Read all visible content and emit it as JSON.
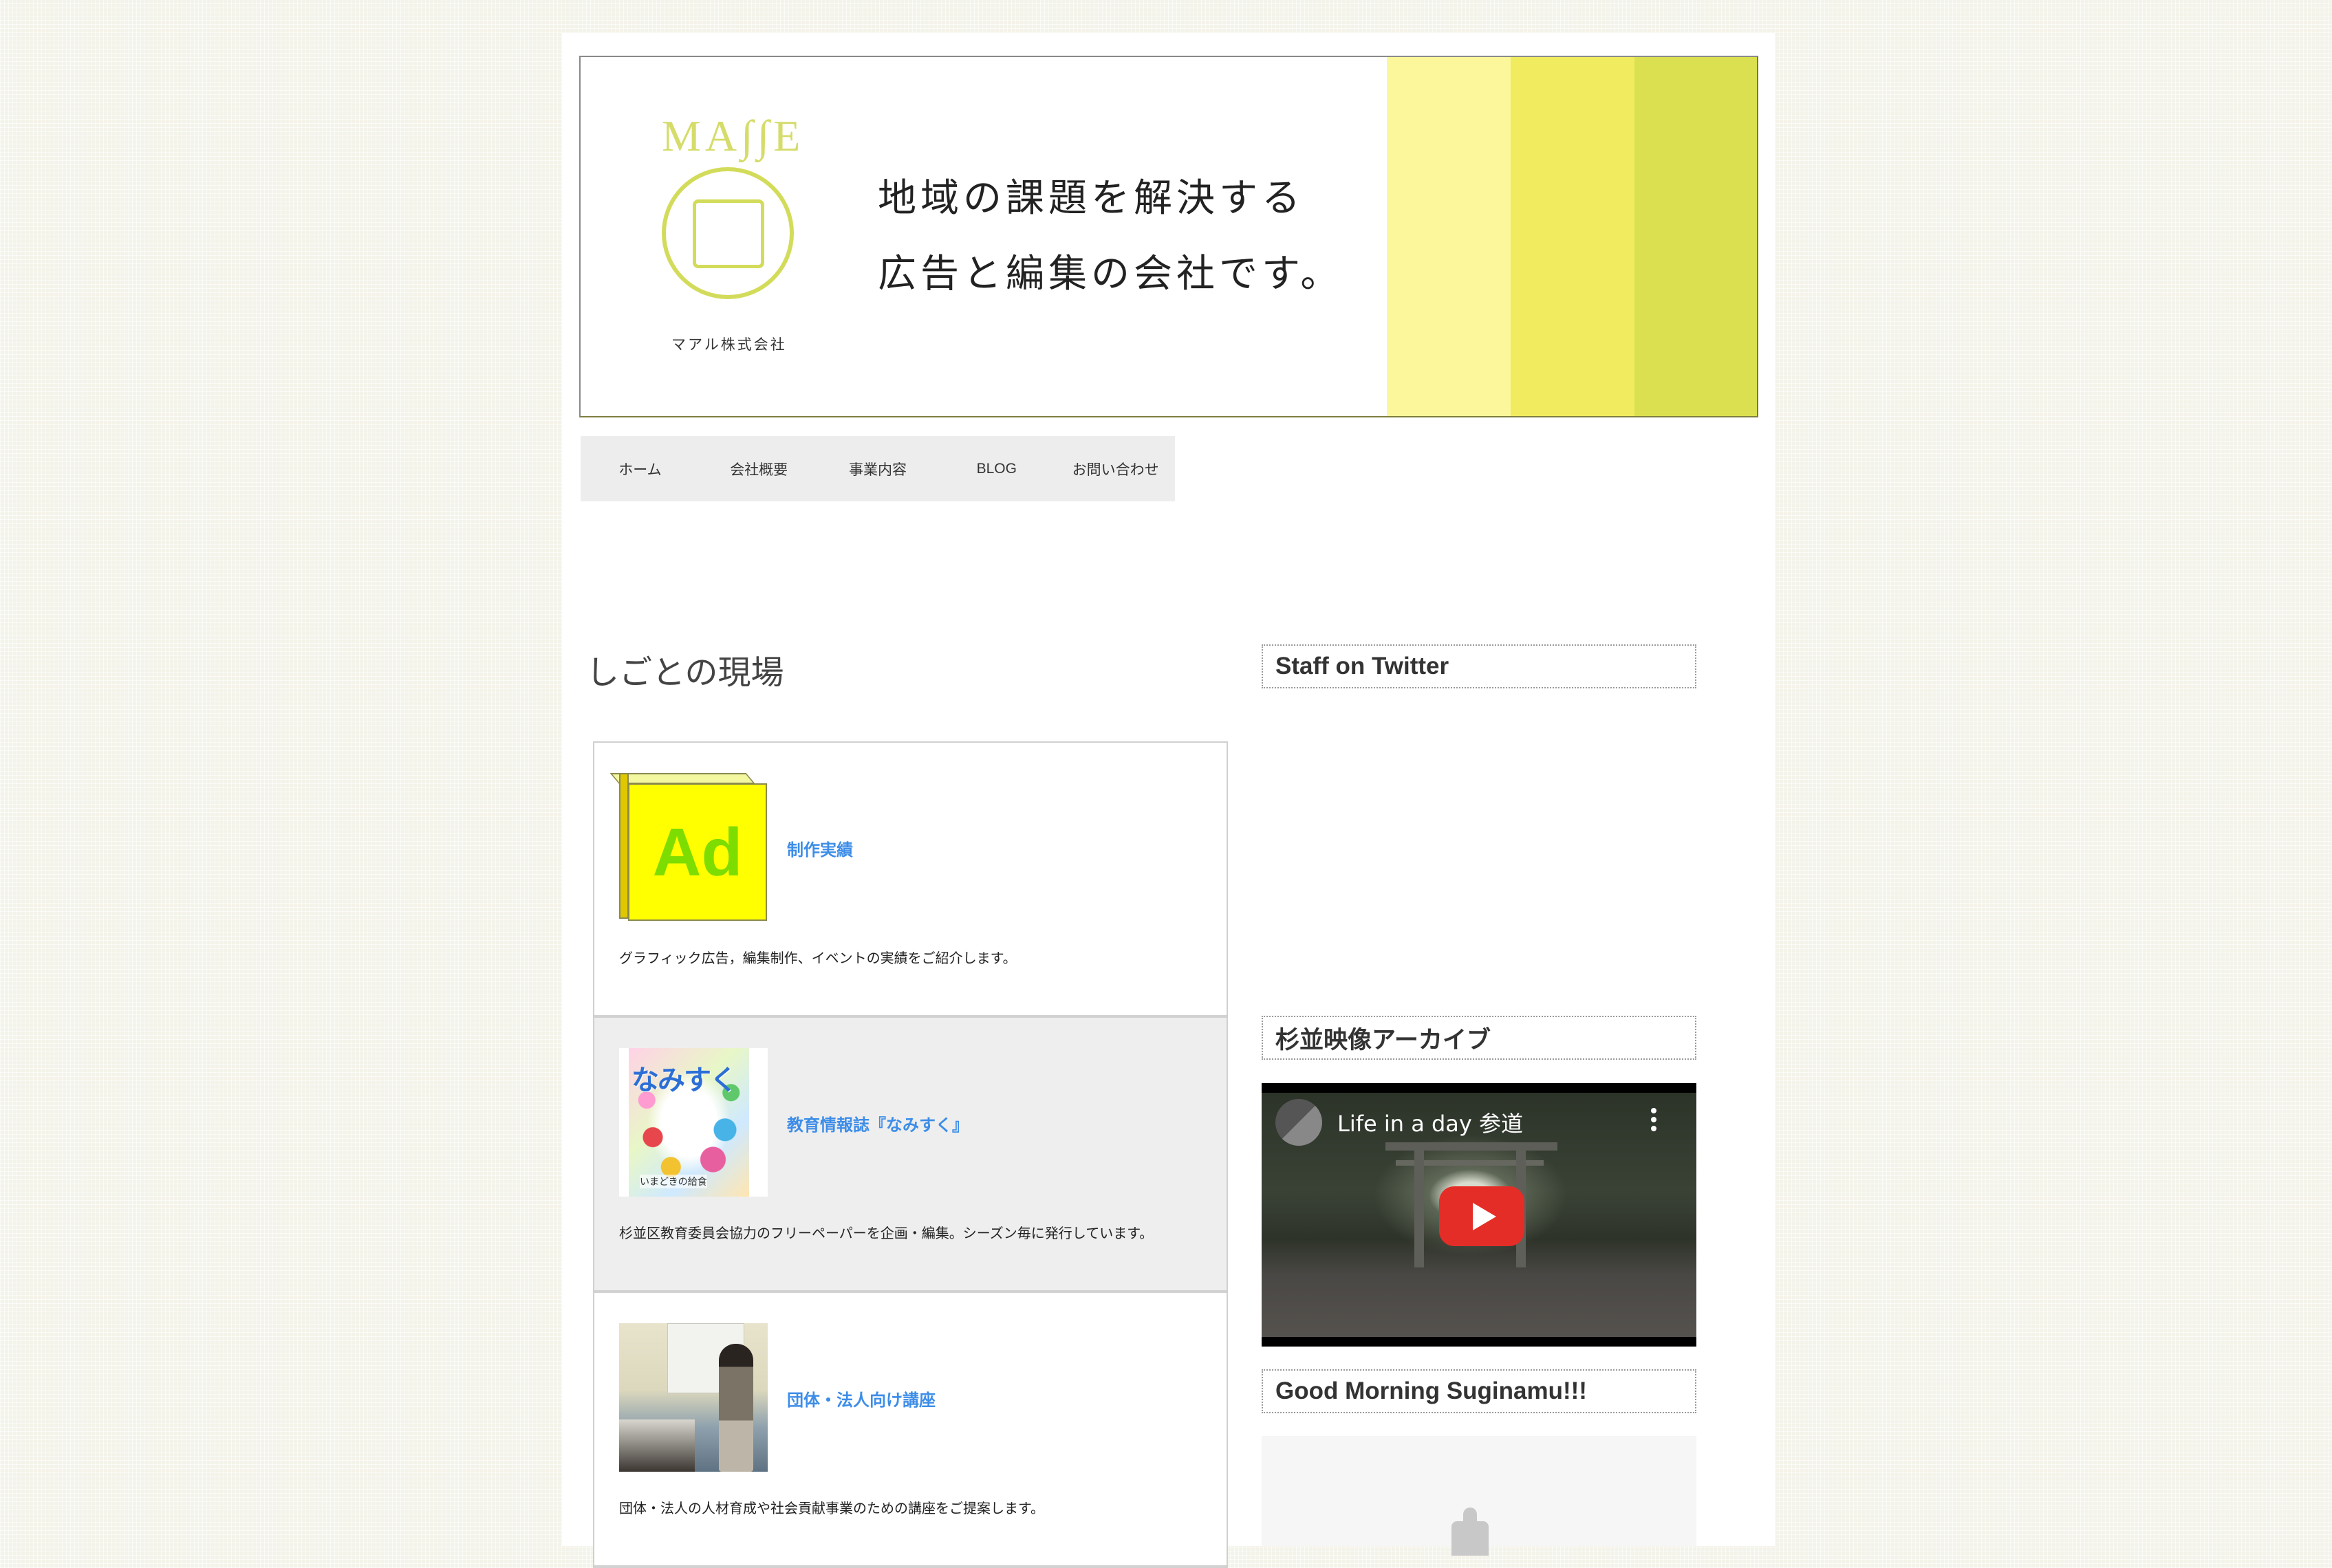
{
  "header": {
    "logo_wordmark": "MA∫∫E",
    "logo_subtitle": "マアル株式会社",
    "tagline_line1": "地域の課題を解決する",
    "tagline_line2": "広告と編集の会社です。",
    "stripe_colors": [
      "#fcf79a",
      "#f0eb5f",
      "#dbe050"
    ]
  },
  "nav": {
    "items": [
      {
        "label": "ホーム"
      },
      {
        "label": "会社概要"
      },
      {
        "label": "事業内容"
      },
      {
        "label": "BLOG"
      },
      {
        "label": "お問い合わせ"
      }
    ]
  },
  "main": {
    "section_title": "しごとの現場",
    "cards": [
      {
        "title": "制作実績",
        "description": "グラフィック広告，編集制作、イベントの実績をご紹介します。",
        "thumb_text": "Ad"
      },
      {
        "title": "教育情報誌『なみすく』",
        "description": "杉並区教育委員会協力のフリーペーパーを企画・編集。シーズン毎に発行しています。",
        "thumb_text": "なみすく",
        "thumb_footer": "いまどきの給食"
      },
      {
        "title": "団体・法人向け講座",
        "description": "団体・法人の人材育成や社会貢献事業のための講座をご提案します。"
      }
    ],
    "link_color": "#3d8de8"
  },
  "sidebar": {
    "widgets": [
      {
        "title": "Staff on Twitter"
      },
      {
        "title": "杉並映像アーカイブ",
        "video_title": "Life in a day 参道"
      },
      {
        "title": "Good Morning Suginamu!!!"
      }
    ]
  }
}
